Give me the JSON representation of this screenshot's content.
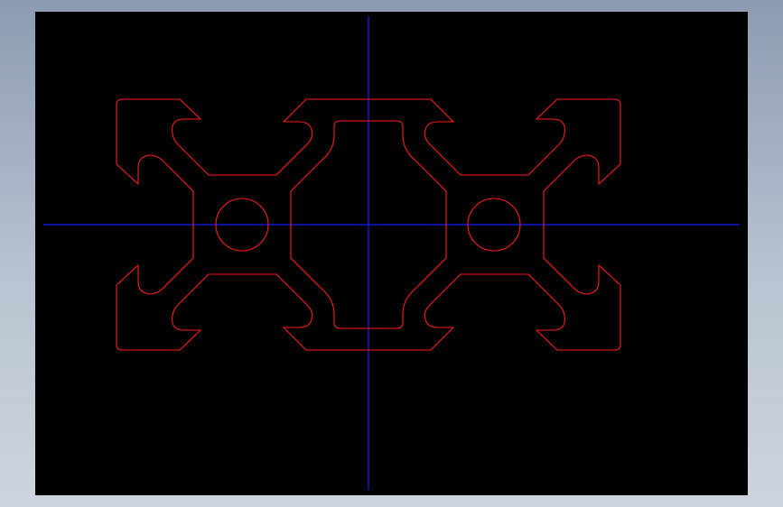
{
  "colors": {
    "background": "#000000",
    "profile": "#ff1a1a",
    "centerlines": "#1a1aff"
  },
  "drawing": {
    "subject": "aluminium-extrusion-profile-cross-section"
  }
}
